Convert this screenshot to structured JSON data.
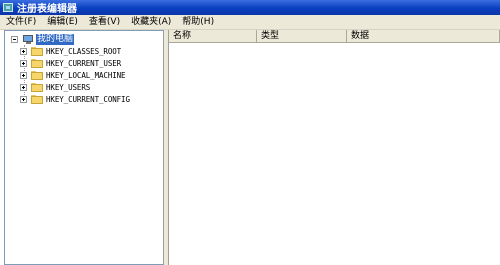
{
  "window": {
    "title": "注册表编辑器",
    "icon": "registry-editor-icon"
  },
  "menu": [
    {
      "label": "文件(F)"
    },
    {
      "label": "编辑(E)"
    },
    {
      "label": "查看(V)"
    },
    {
      "label": "收藏夹(A)"
    },
    {
      "label": "帮助(H)"
    }
  ],
  "tree": {
    "root": {
      "label": "我的电脑",
      "icon": "computer-icon",
      "expanded": true,
      "selected": true
    },
    "items": [
      {
        "label": "HKEY_CLASSES_ROOT",
        "icon": "folder-icon"
      },
      {
        "label": "HKEY_CURRENT_USER",
        "icon": "folder-icon"
      },
      {
        "label": "HKEY_LOCAL_MACHINE",
        "icon": "folder-icon"
      },
      {
        "label": "HKEY_USERS",
        "icon": "folder-icon"
      },
      {
        "label": "HKEY_CURRENT_CONFIG",
        "icon": "folder-icon"
      }
    ]
  },
  "list": {
    "columns": [
      {
        "label": "名称"
      },
      {
        "label": "类型"
      },
      {
        "label": "数据"
      }
    ]
  },
  "colors": {
    "titlebar": "#0a3fbf",
    "selection": "#316ac5",
    "chrome": "#ece9d8"
  }
}
